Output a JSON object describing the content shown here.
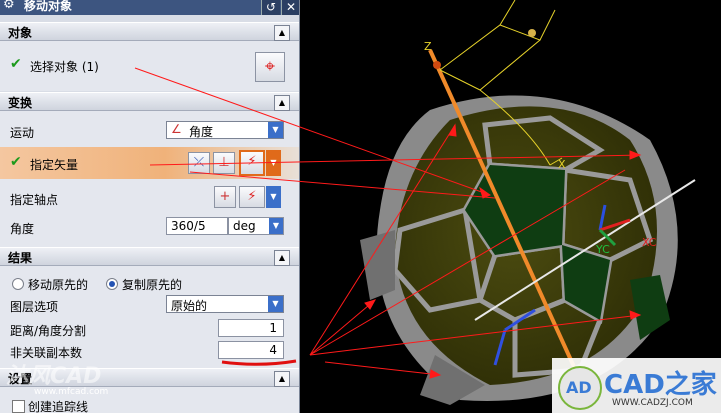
{
  "dialog": {
    "title": "移动对象",
    "restore_glyph": "↺",
    "close_glyph": "✕"
  },
  "object_section": {
    "header": "对象",
    "select_label": "选择对象 (1)"
  },
  "transform_section": {
    "header": "变换",
    "motion_label": "运动",
    "motion_value": "角度",
    "vector_label": "指定矢量",
    "pivot_label": "指定轴点",
    "angle_label": "角度",
    "angle_value": "360/5",
    "angle_unit": "deg"
  },
  "result_section": {
    "header": "结果",
    "move_original": "移动原先的",
    "copy_original": "复制原先的",
    "layer_label": "图层选项",
    "layer_value": "原始的",
    "distance_label": "距离/角度分割",
    "distance_value": "1",
    "copies_label": "非关联副本数",
    "copies_value": "4"
  },
  "settings_section": {
    "header": "设置",
    "trace_label": "创建追踪线"
  },
  "viewport": {
    "axis_z": "Z",
    "axis_x": "X",
    "axis_yc": "YC",
    "axis_xc": "XC"
  },
  "watermarks": {
    "left_brand": "沐风CAD",
    "left_url": "www.mfcad.com",
    "right_brand": "CAD之家",
    "right_url": "WWW.CADZJ.COM",
    "right_badge": "AD"
  },
  "colors": {
    "title_bar": "#3d5580",
    "highlight_row": "#f0b27a",
    "annotation_red": "#ff1a1a",
    "panel_yellow": "#5a5a12",
    "panel_green": "#0f3d12"
  }
}
